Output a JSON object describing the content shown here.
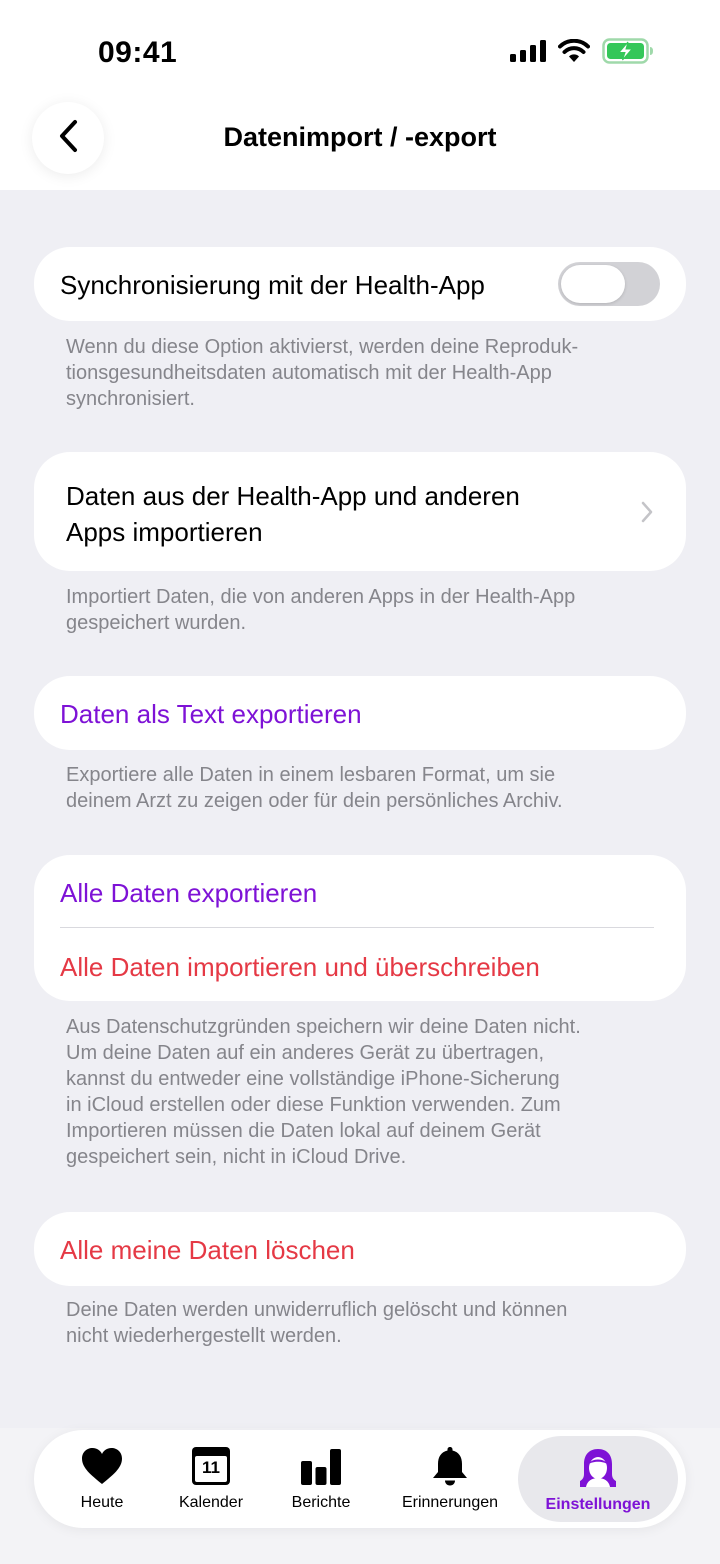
{
  "status": {
    "time": "09:41"
  },
  "nav": {
    "title": "Datenimport / -export"
  },
  "sync": {
    "label": "Synchronisierung mit der Health-App",
    "enabled": false,
    "footnote_line1": "Wenn du diese Option aktivierst, werden deine Reproduk-",
    "footnote_line2": "tionsgesundheitsdaten automatisch mit der Health-App",
    "footnote_line3": "synchronisiert."
  },
  "import_health": {
    "label_line1": "Daten aus der Health-App und anderen",
    "label_line2": "Apps importieren",
    "footnote_line1": "Importiert Daten, die von anderen Apps in der Health-App",
    "footnote_line2": "gespeichert wurden."
  },
  "export_text": {
    "label": "Daten als Text exportieren",
    "footnote_line1": "Exportiere alle Daten in einem lesbaren Format, um sie",
    "footnote_line2": "deinem Arzt zu zeigen oder für dein persönliches Archiv."
  },
  "all_data": {
    "export_label": "Alle Daten exportieren",
    "import_label": "Alle Daten importieren und überschreiben",
    "footnote_line1": "Aus Datenschutzgründen speichern wir deine Daten nicht.",
    "footnote_line2": "Um deine Daten auf ein anderes Gerät zu übertragen,",
    "footnote_line3": "kannst du entweder eine vollständige iPhone-Sicherung",
    "footnote_line4": "in iCloud erstellen oder diese Funktion verwenden. Zum",
    "footnote_line5": "Importieren müssen die Daten lokal auf deinem Gerät",
    "footnote_line6": "gespeichert sein, nicht in iCloud Drive."
  },
  "delete": {
    "label": "Alle meine Daten löschen",
    "footnote_line1": "Deine Daten werden unwiderruflich gelöscht und können",
    "footnote_line2": "nicht wiederhergestellt werden."
  },
  "tabbar": {
    "tabs": [
      {
        "label": "Heute",
        "icon": "heart-icon"
      },
      {
        "label": "Kalender",
        "icon": "calendar-icon",
        "icon_text": "11"
      },
      {
        "label": "Berichte",
        "icon": "bar-chart-icon"
      },
      {
        "label": "Erinnerungen",
        "icon": "bell-icon"
      },
      {
        "label": "Einstellungen",
        "icon": "person-icon",
        "active": true
      }
    ]
  },
  "colors": {
    "accent_purple": "#7e12d6",
    "destructive_red": "#e53945",
    "battery_green": "#34c759",
    "background": "#efeff4"
  }
}
